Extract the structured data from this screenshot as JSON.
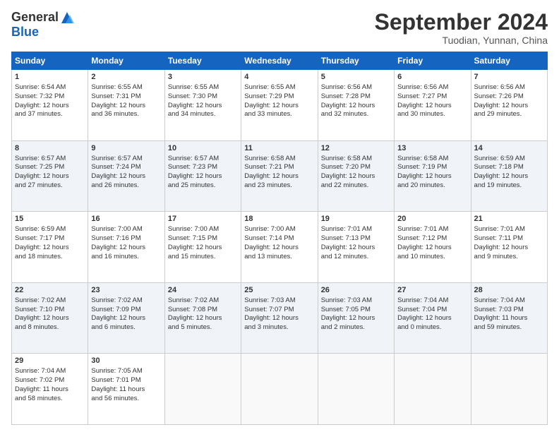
{
  "header": {
    "logo_general": "General",
    "logo_blue": "Blue",
    "month_title": "September 2024",
    "location": "Tuodian, Yunnan, China"
  },
  "days_of_week": [
    "Sunday",
    "Monday",
    "Tuesday",
    "Wednesday",
    "Thursday",
    "Friday",
    "Saturday"
  ],
  "weeks": [
    [
      {
        "day": "1",
        "lines": [
          "Sunrise: 6:54 AM",
          "Sunset: 7:32 PM",
          "Daylight: 12 hours",
          "and 37 minutes."
        ]
      },
      {
        "day": "2",
        "lines": [
          "Sunrise: 6:55 AM",
          "Sunset: 7:31 PM",
          "Daylight: 12 hours",
          "and 36 minutes."
        ]
      },
      {
        "day": "3",
        "lines": [
          "Sunrise: 6:55 AM",
          "Sunset: 7:30 PM",
          "Daylight: 12 hours",
          "and 34 minutes."
        ]
      },
      {
        "day": "4",
        "lines": [
          "Sunrise: 6:55 AM",
          "Sunset: 7:29 PM",
          "Daylight: 12 hours",
          "and 33 minutes."
        ]
      },
      {
        "day": "5",
        "lines": [
          "Sunrise: 6:56 AM",
          "Sunset: 7:28 PM",
          "Daylight: 12 hours",
          "and 32 minutes."
        ]
      },
      {
        "day": "6",
        "lines": [
          "Sunrise: 6:56 AM",
          "Sunset: 7:27 PM",
          "Daylight: 12 hours",
          "and 30 minutes."
        ]
      },
      {
        "day": "7",
        "lines": [
          "Sunrise: 6:56 AM",
          "Sunset: 7:26 PM",
          "Daylight: 12 hours",
          "and 29 minutes."
        ]
      }
    ],
    [
      {
        "day": "8",
        "lines": [
          "Sunrise: 6:57 AM",
          "Sunset: 7:25 PM",
          "Daylight: 12 hours",
          "and 27 minutes."
        ]
      },
      {
        "day": "9",
        "lines": [
          "Sunrise: 6:57 AM",
          "Sunset: 7:24 PM",
          "Daylight: 12 hours",
          "and 26 minutes."
        ]
      },
      {
        "day": "10",
        "lines": [
          "Sunrise: 6:57 AM",
          "Sunset: 7:23 PM",
          "Daylight: 12 hours",
          "and 25 minutes."
        ]
      },
      {
        "day": "11",
        "lines": [
          "Sunrise: 6:58 AM",
          "Sunset: 7:21 PM",
          "Daylight: 12 hours",
          "and 23 minutes."
        ]
      },
      {
        "day": "12",
        "lines": [
          "Sunrise: 6:58 AM",
          "Sunset: 7:20 PM",
          "Daylight: 12 hours",
          "and 22 minutes."
        ]
      },
      {
        "day": "13",
        "lines": [
          "Sunrise: 6:58 AM",
          "Sunset: 7:19 PM",
          "Daylight: 12 hours",
          "and 20 minutes."
        ]
      },
      {
        "day": "14",
        "lines": [
          "Sunrise: 6:59 AM",
          "Sunset: 7:18 PM",
          "Daylight: 12 hours",
          "and 19 minutes."
        ]
      }
    ],
    [
      {
        "day": "15",
        "lines": [
          "Sunrise: 6:59 AM",
          "Sunset: 7:17 PM",
          "Daylight: 12 hours",
          "and 18 minutes."
        ]
      },
      {
        "day": "16",
        "lines": [
          "Sunrise: 7:00 AM",
          "Sunset: 7:16 PM",
          "Daylight: 12 hours",
          "and 16 minutes."
        ]
      },
      {
        "day": "17",
        "lines": [
          "Sunrise: 7:00 AM",
          "Sunset: 7:15 PM",
          "Daylight: 12 hours",
          "and 15 minutes."
        ]
      },
      {
        "day": "18",
        "lines": [
          "Sunrise: 7:00 AM",
          "Sunset: 7:14 PM",
          "Daylight: 12 hours",
          "and 13 minutes."
        ]
      },
      {
        "day": "19",
        "lines": [
          "Sunrise: 7:01 AM",
          "Sunset: 7:13 PM",
          "Daylight: 12 hours",
          "and 12 minutes."
        ]
      },
      {
        "day": "20",
        "lines": [
          "Sunrise: 7:01 AM",
          "Sunset: 7:12 PM",
          "Daylight: 12 hours",
          "and 10 minutes."
        ]
      },
      {
        "day": "21",
        "lines": [
          "Sunrise: 7:01 AM",
          "Sunset: 7:11 PM",
          "Daylight: 12 hours",
          "and 9 minutes."
        ]
      }
    ],
    [
      {
        "day": "22",
        "lines": [
          "Sunrise: 7:02 AM",
          "Sunset: 7:10 PM",
          "Daylight: 12 hours",
          "and 8 minutes."
        ]
      },
      {
        "day": "23",
        "lines": [
          "Sunrise: 7:02 AM",
          "Sunset: 7:09 PM",
          "Daylight: 12 hours",
          "and 6 minutes."
        ]
      },
      {
        "day": "24",
        "lines": [
          "Sunrise: 7:02 AM",
          "Sunset: 7:08 PM",
          "Daylight: 12 hours",
          "and 5 minutes."
        ]
      },
      {
        "day": "25",
        "lines": [
          "Sunrise: 7:03 AM",
          "Sunset: 7:07 PM",
          "Daylight: 12 hours",
          "and 3 minutes."
        ]
      },
      {
        "day": "26",
        "lines": [
          "Sunrise: 7:03 AM",
          "Sunset: 7:05 PM",
          "Daylight: 12 hours",
          "and 2 minutes."
        ]
      },
      {
        "day": "27",
        "lines": [
          "Sunrise: 7:04 AM",
          "Sunset: 7:04 PM",
          "Daylight: 12 hours",
          "and 0 minutes."
        ]
      },
      {
        "day": "28",
        "lines": [
          "Sunrise: 7:04 AM",
          "Sunset: 7:03 PM",
          "Daylight: 11 hours",
          "and 59 minutes."
        ]
      }
    ],
    [
      {
        "day": "29",
        "lines": [
          "Sunrise: 7:04 AM",
          "Sunset: 7:02 PM",
          "Daylight: 11 hours",
          "and 58 minutes."
        ]
      },
      {
        "day": "30",
        "lines": [
          "Sunrise: 7:05 AM",
          "Sunset: 7:01 PM",
          "Daylight: 11 hours",
          "and 56 minutes."
        ]
      },
      null,
      null,
      null,
      null,
      null
    ]
  ]
}
